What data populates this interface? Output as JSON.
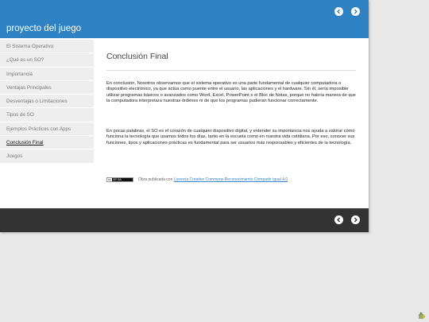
{
  "header": {
    "site_title": "proyecto del juego"
  },
  "sidebar": {
    "items": [
      {
        "label": "El Sistema Operativo",
        "active": false
      },
      {
        "label": "¿Qué es un SO?",
        "active": false
      },
      {
        "label": "Importancia",
        "active": false
      },
      {
        "label": "Ventajas Principales",
        "active": false
      },
      {
        "label": "Desventajas o Limitaciones",
        "active": false
      },
      {
        "label": "Tipos de SO",
        "active": false
      },
      {
        "label": "Ejemplos Prácticos con Apps",
        "active": false
      },
      {
        "label": "Conclusión Final",
        "active": true
      },
      {
        "label": "Juegos",
        "active": false
      }
    ]
  },
  "main": {
    "title": "Conclusión Final",
    "paragraph1": "En conclusión, Nosotros observamos que el sistema operativo es una parte fundamental de cualquier computadora o dispositivo electrónico, ya que actúa como puente entre el usuario, las aplicaciones y el hardware. Sin él, sería imposible utilizar programas básicos o avanzados como Word, Excel, PowerPoint o el Bloc de Notas, porque no habría manera de que la computadora interpretara nuestras órdenes ni de que los programas pudieran funcionar correctamente.",
    "paragraph2": "En pocas palabras, el SO es el corazón de cualquier dispositivo digital, y entender su importancia nos ayuda a valorar cómo funciona la tecnología que usamos todos los días, tanto en la escuela como en nuestra vida cotidiana. Por eso, conocer sus funciones, tipos y aplicaciones prácticas es fundamental para ser usuarios más responsables y eficientes de la tecnología."
  },
  "license": {
    "badge": "BY SA",
    "badge_cc": "cc",
    "prefix": "Obra publicada con",
    "link_text": "Licencia Creative Commons Reconocimiento Compartir igual 4.0"
  },
  "icons": {
    "prev": "chevron-left-icon",
    "next": "chevron-right-icon",
    "corner": "puzzle-icon"
  },
  "colors": {
    "header_bg": "#2e82c4",
    "footer_bg": "#333333",
    "sidebar_bg": "#eeeeee",
    "link": "#3a85c6"
  }
}
